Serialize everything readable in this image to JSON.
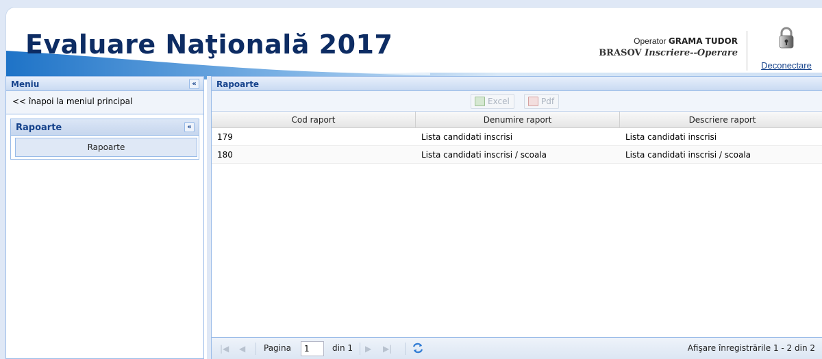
{
  "header": {
    "title": "Evaluare Naţională 2017",
    "operator_prefix": "Operator",
    "operator_name": "GRAMA TUDOR",
    "location": "BRASOV",
    "role": "Inscriere--Operare",
    "logout_label": "Deconectare"
  },
  "menu": {
    "title": "Meniu",
    "back_label": "<< înapoi la meniul principal",
    "section_title": "Rapoarte",
    "items": [
      {
        "label": "Rapoarte"
      }
    ]
  },
  "main": {
    "title": "Rapoarte",
    "toolbar": {
      "excel_label": "Excel",
      "pdf_label": "Pdf"
    },
    "columns": [
      "Cod raport",
      "Denumire raport",
      "Descriere raport"
    ],
    "rows": [
      [
        "179",
        "Lista candidati inscrisi",
        "Lista candidati inscrisi"
      ],
      [
        "180",
        "Lista candidati inscrisi / scoala",
        "Lista candidati inscrisi / scoala"
      ]
    ],
    "paging": {
      "page_label": "Pagina",
      "page_value": "1",
      "of_label": "din 1",
      "summary": "Afişare înregistrările 1 - 2 din 2"
    }
  },
  "colors": {
    "accent": "#15428b",
    "title": "#0d2c63",
    "panel_border": "#99bbe8"
  }
}
